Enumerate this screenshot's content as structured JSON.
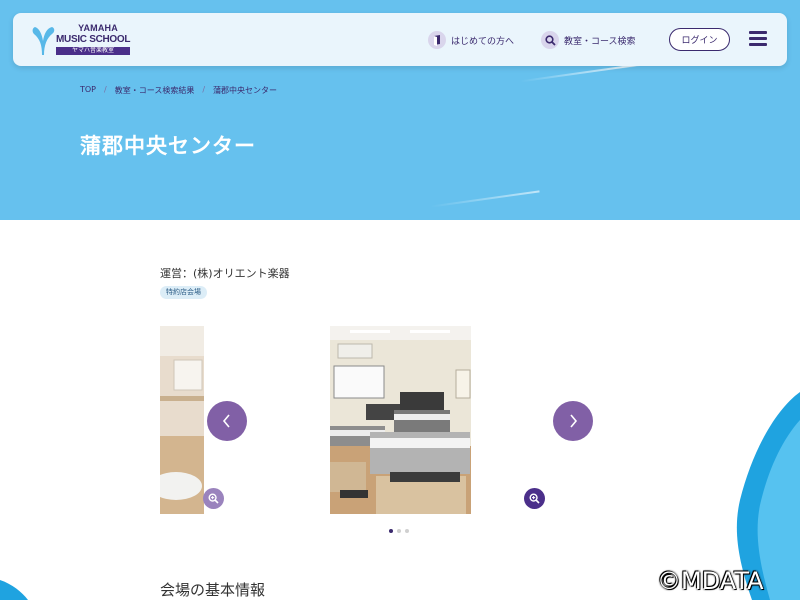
{
  "brand": {
    "line1": "YAMAHA",
    "line2": "MUSIC SCHOOL",
    "line3": "ヤマハ音楽教室"
  },
  "header": {
    "nav_first_time": "はじめての方へ",
    "nav_search": "教室・コース検索",
    "login_label": "ログイン"
  },
  "breadcrumb": {
    "items": [
      "TOP",
      "教室・コース検索結果",
      "蒲郡中央センター"
    ],
    "separator": "/"
  },
  "page": {
    "title": "蒲郡中央センター",
    "operator": "運営：(株)オリエント楽器",
    "badge": "特約店会場"
  },
  "carousel": {
    "slide_count": 3,
    "active_index": 0
  },
  "section": {
    "basic_info_title": "会場の基本情報"
  },
  "watermark": "©MDATA",
  "colors": {
    "hero_bg": "#66c1ee",
    "brand_purple": "#3b2a6e",
    "arrow_purple": "#8160a6"
  },
  "icons": [
    "yamaha-logo-mark",
    "book-icon",
    "search-icon",
    "hamburger-menu-icon",
    "chevron-left-icon",
    "chevron-right-icon",
    "zoom-icon"
  ]
}
